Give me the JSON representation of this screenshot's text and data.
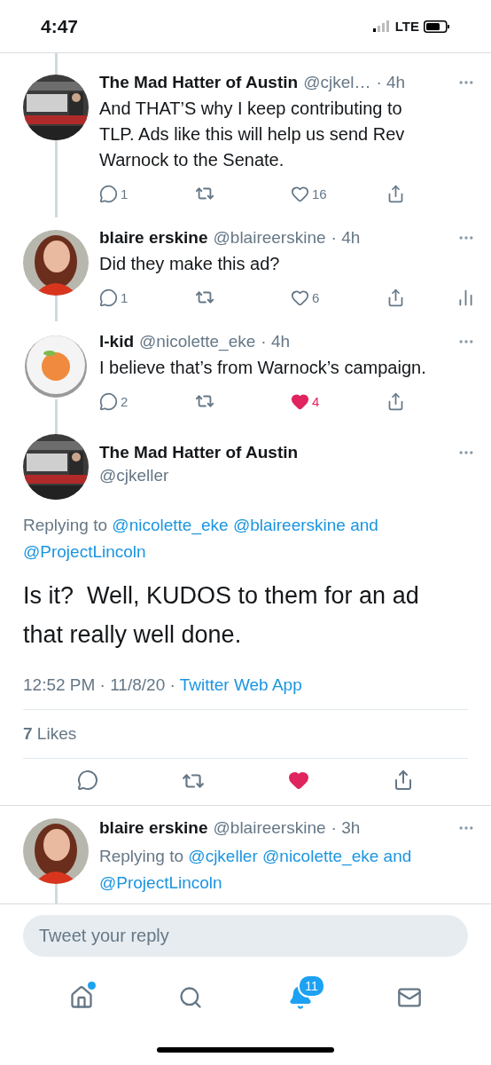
{
  "status_bar": {
    "time": "4:47",
    "network": "LTE"
  },
  "thread": [
    {
      "name": "The Mad Hatter of Austin",
      "handle": "@cjkel…",
      "time": "· 4h",
      "text": "And THAT’S why I keep contributing to TLP. Ads like this will help us send Rev Warnock to the Senate.",
      "replies": "1",
      "likes": "16",
      "liked": false,
      "analytics": false
    },
    {
      "name": "blaire erskine",
      "handle": "@blaireerskine",
      "time": "· 4h",
      "text": "Did they make this ad?",
      "replies": "1",
      "likes": "6",
      "liked": false,
      "analytics": true
    },
    {
      "name": "l-kid",
      "handle": "@nicolette_eke",
      "time": "· 4h",
      "text": "I believe that’s from Warnock’s campaign.",
      "replies": "2",
      "likes": "4",
      "liked": true,
      "analytics": false
    }
  ],
  "main_tweet": {
    "name": "The Mad Hatter of Austin",
    "handle": "@cjkeller",
    "replying_label": "Replying to",
    "mentions": [
      "@nicolette_eke",
      "@blaireerskine",
      "and",
      "@ProjectLincoln"
    ],
    "text": "Is it?  Well, KUDOS to them for an ad that really well done.",
    "timestamp": "12:52 PM · 11/8/20 · ",
    "source": "Twitter Web App",
    "likes_line": "**7** Likes",
    "liked": true
  },
  "reply": {
    "name": "blaire erskine",
    "handle": "@blaireerskine",
    "time": "· 3h",
    "replying_label": "Replying to",
    "mentions": [
      "@cjkeller",
      "@nicolette_eke",
      "and",
      "@ProjectLincoln"
    ]
  },
  "composer": {
    "placeholder": "Tweet your reply"
  },
  "tab_bar": [
    {
      "kind": "home",
      "selected": false,
      "dot": true
    },
    {
      "kind": "search",
      "selected": false
    },
    {
      "kind": "notifications",
      "selected": true,
      "badge": "11"
    },
    {
      "kind": "messages",
      "selected": false
    }
  ]
}
